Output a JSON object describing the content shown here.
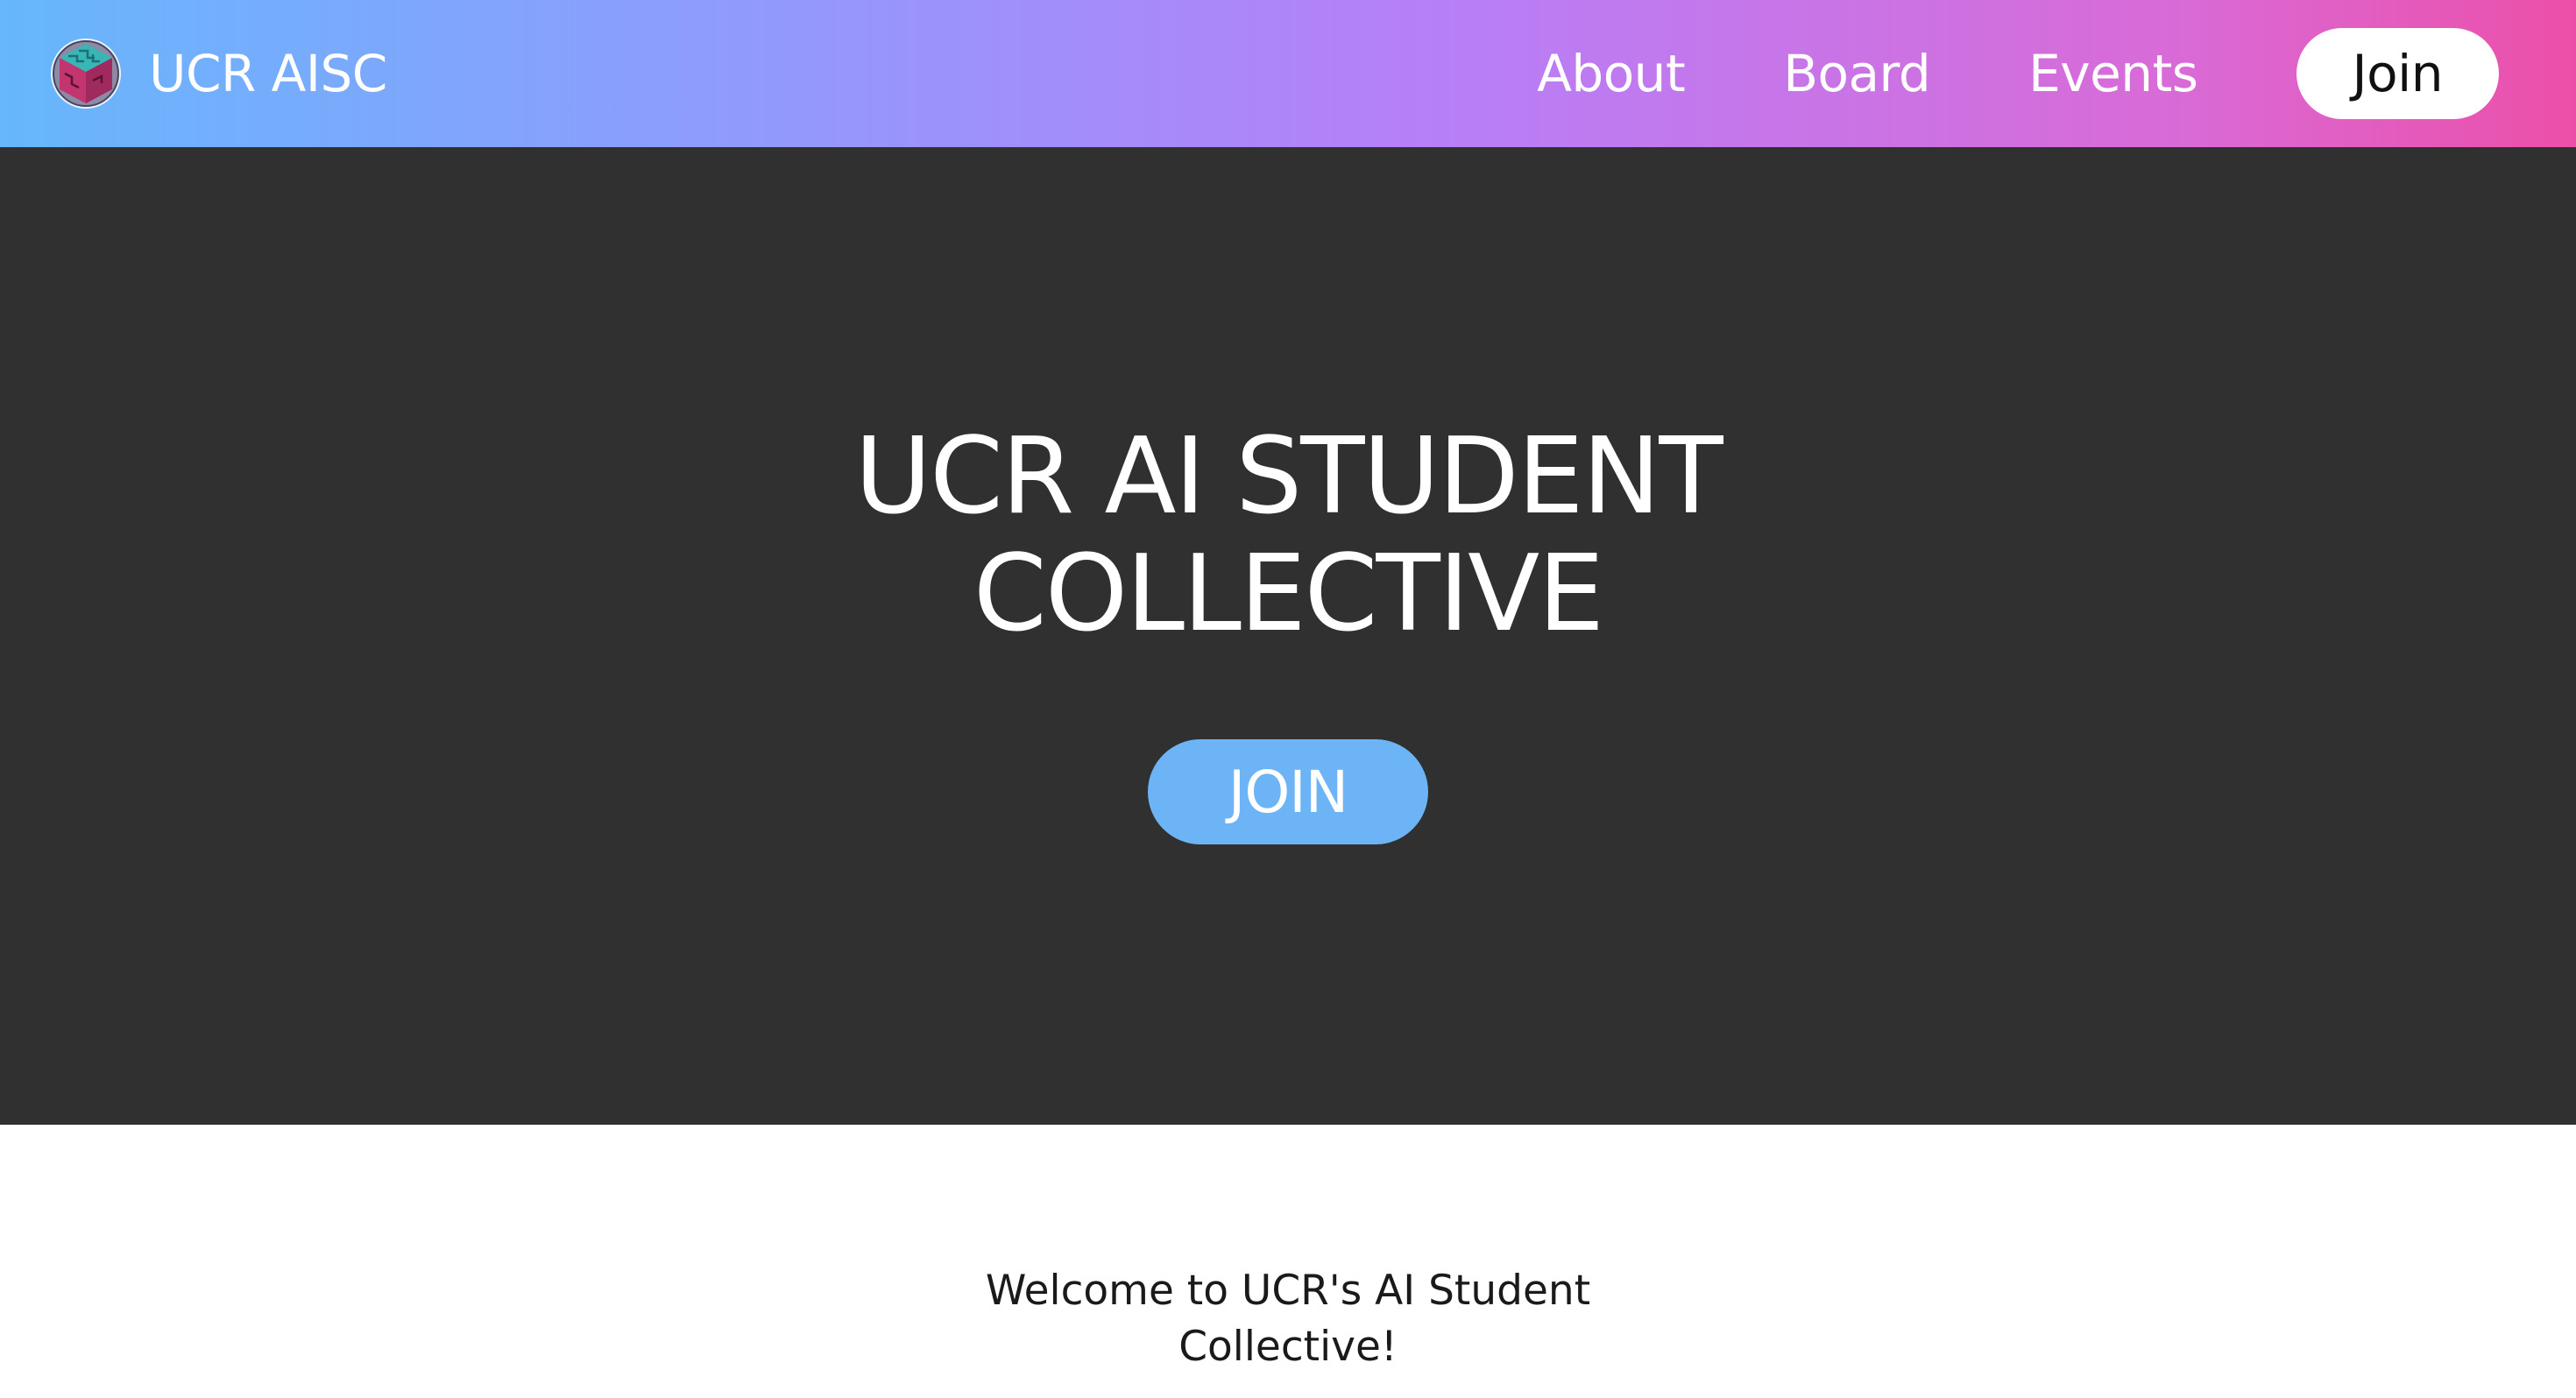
{
  "header": {
    "brand_name": "UCR AISC",
    "logo_icon": "aisc-cube-logo",
    "nav": [
      {
        "label": "About"
      },
      {
        "label": "Board"
      },
      {
        "label": "Events"
      }
    ],
    "join_label": "Join"
  },
  "hero": {
    "title_line1": "UCR AI STUDENT",
    "title_line2": "COLLECTIVE",
    "join_label": "JOIN"
  },
  "intro": {
    "welcome_line1": "Welcome to UCR's AI Student",
    "welcome_line2": "Collective!"
  },
  "colors": {
    "gradient_start": "#66b7fb",
    "gradient_mid": "#b77ff7",
    "gradient_end": "#ec4fa8",
    "hero_bg": "#303030",
    "hero_button": "#6db4f6"
  }
}
